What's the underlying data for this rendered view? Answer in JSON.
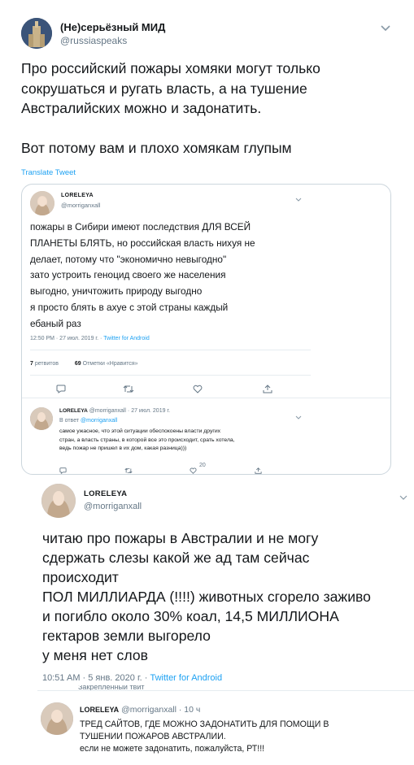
{
  "main_tweet": {
    "display_name": "(Не)серьёзный МИД",
    "handle": "@russiaspeaks",
    "text_line1": "Про российский пожары хомяки могут только",
    "text_line2": "сокрушаться и ругать власть, а на тушение",
    "text_line3": "Австралийских можно и задонатить.",
    "text_line5": "Вот потому вам и плохо хомякам глупым",
    "translate": "Translate Tweet",
    "caret_icon": "chevron-down-icon"
  },
  "quoted_1": {
    "name": "LORELEYA",
    "handle": "@morriganxall",
    "lines": [
      "пожары в Сибири имеют последствия ДЛЯ ВСЕЙ",
      "ПЛАНЕТЫ БЛЯТЬ, но российская власть нихуя не",
      "делает, потому что \"экономично невыгодно\"",
      "зато устроить геноцид своего же населения",
      "выгодно, уничтожить природу выгодно",
      "я просто блять в ахуе с этой страны каждый",
      "ебаный раз"
    ],
    "time": "12:50 PM · 27 июл. 2019 г. ·",
    "source": "Twitter for Android",
    "retweets_num": "7",
    "retweets_label": "ретвитов",
    "likes_num": "69",
    "likes_label": "Отметки «Нравится»"
  },
  "reply_1": {
    "name": "LORELEYA",
    "meta": "@morriganxall · 27 июл. 2019 г.",
    "reply_to_prefix": "В ответ",
    "reply_to_handle": "@morriganxall",
    "lines": [
      "самое ужасное, что этой ситуации обеспокоены власти других",
      "стран, а власть страны, в которой все это происходит, срать хотела,",
      "ведь пожар не пришел в их дом, какая разница)))"
    ],
    "like_count": "20"
  },
  "quoted_2": {
    "name": "LORELEYA",
    "handle": "@morriganxall",
    "lines": [
      "читаю про пожары в Австралии и не могу",
      "сдержать слезы какой же ад там сейчас",
      "происходит",
      "ПОЛ МИЛЛИАРДА (!!!!) животных сгорело заживо",
      "и погибло около 30% коал, 14,5 МИЛЛИОНА",
      "гектаров земли выгорело",
      "у меня нет слов"
    ],
    "time": "10:51 AM · 5 янв. 2020 г. ·",
    "source": "Twitter for Android",
    "pinned": "Закреплённый твит"
  },
  "reply_2": {
    "name": "LORELEYA",
    "meta": "@morriganxall · 10 ч",
    "lines": [
      "ТРЕД САЙТОВ, ГДЕ МОЖНО ЗАДОНАТИТЬ ДЛЯ ПОМОЩИ В",
      "ТУШЕНИИ ПОЖАРОВ АВСТРАЛИИ.",
      "если не можете задонатить, пожалуйста, РТ!!!"
    ]
  }
}
